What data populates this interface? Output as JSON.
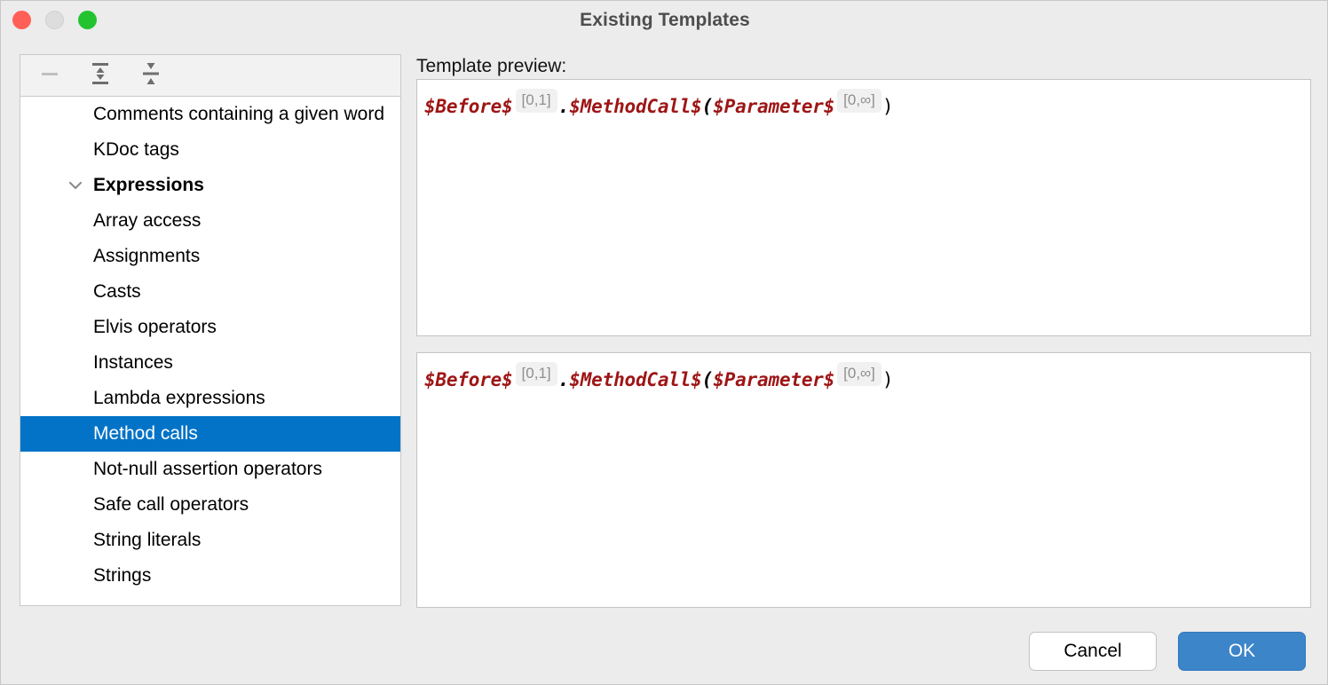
{
  "window": {
    "title": "Existing Templates",
    "traffic_lights": [
      {
        "name": "close",
        "color": "#ff5f57"
      },
      {
        "name": "minimize",
        "color": "#dddddd"
      },
      {
        "name": "maximize",
        "color": "#22c32f"
      }
    ]
  },
  "toolbar": {
    "buttons": [
      {
        "icon": "minus-icon",
        "label": "Remove",
        "disabled": true
      },
      {
        "icon": "expand-all-icon",
        "label": "Expand All",
        "disabled": false
      },
      {
        "icon": "collapse-all-icon",
        "label": "Collapse All",
        "disabled": false
      }
    ]
  },
  "tree": {
    "items": [
      {
        "label": "Comments containing a given word",
        "type": "leaf",
        "selected": false,
        "clipped": true
      },
      {
        "label": "KDoc tags",
        "type": "leaf",
        "selected": false
      },
      {
        "label": "Expressions",
        "type": "group",
        "expanded": true,
        "selected": false
      },
      {
        "label": "Array access",
        "type": "leaf",
        "selected": false
      },
      {
        "label": "Assignments",
        "type": "leaf",
        "selected": false
      },
      {
        "label": "Casts",
        "type": "leaf",
        "selected": false
      },
      {
        "label": "Elvis operators",
        "type": "leaf",
        "selected": false
      },
      {
        "label": "Instances",
        "type": "leaf",
        "selected": false
      },
      {
        "label": "Lambda expressions",
        "type": "leaf",
        "selected": false
      },
      {
        "label": "Method calls",
        "type": "leaf",
        "selected": true
      },
      {
        "label": "Not-null assertion operators",
        "type": "leaf",
        "selected": false,
        "clipped": true
      },
      {
        "label": "Safe call operators",
        "type": "leaf",
        "selected": false
      },
      {
        "label": "String literals",
        "type": "leaf",
        "selected": false
      },
      {
        "label": "Strings",
        "type": "leaf",
        "selected": false
      }
    ],
    "selection_color": "#0273c7"
  },
  "preview": {
    "label": "Template preview:",
    "boxes": [
      {
        "tokens": [
          {
            "kind": "var",
            "text": "$Before$"
          },
          {
            "kind": "count",
            "text": "[0,1]"
          },
          {
            "kind": "punct",
            "text": "."
          },
          {
            "kind": "var",
            "text": "$MethodCall$"
          },
          {
            "kind": "punct",
            "text": "("
          },
          {
            "kind": "var",
            "text": "$Parameter$"
          },
          {
            "kind": "count",
            "text": "[0,∞]"
          },
          {
            "kind": "paren",
            "text": ")"
          }
        ]
      },
      {
        "tokens": [
          {
            "kind": "var",
            "text": "$Before$"
          },
          {
            "kind": "count",
            "text": "[0,1]"
          },
          {
            "kind": "punct",
            "text": "."
          },
          {
            "kind": "var",
            "text": "$MethodCall$"
          },
          {
            "kind": "punct",
            "text": "("
          },
          {
            "kind": "var",
            "text": "$Parameter$"
          },
          {
            "kind": "count",
            "text": "[0,∞]"
          },
          {
            "kind": "paren",
            "text": ")"
          }
        ]
      }
    ],
    "variable_color": "#9e1515",
    "count_color": "#8f8f8f"
  },
  "footer": {
    "cancel_label": "Cancel",
    "ok_label": "OK",
    "ok_color": "#3c85c9"
  }
}
